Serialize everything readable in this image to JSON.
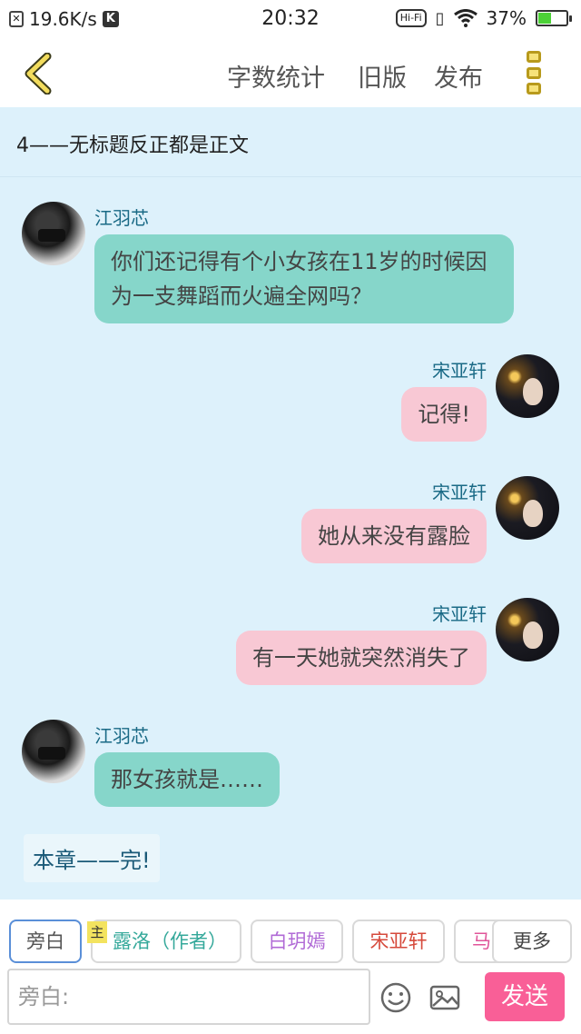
{
  "status_bar": {
    "net_speed": "19.6K/s",
    "time": "20:32",
    "hifi": "Hi-Fi",
    "battery": "37%",
    "battery_level": 0.37
  },
  "top_nav": {
    "word_count": "字数统计",
    "old_version": "旧版",
    "publish": "发布"
  },
  "chapter": {
    "title": "4——无标题反正都是正文"
  },
  "messages": [
    {
      "speaker": "江羽芯",
      "text": "你们还记得有个小女孩在11岁的时候因为一支舞蹈而火遍全网吗？",
      "side": "left"
    },
    {
      "speaker": "宋亚轩",
      "text": "记得!",
      "side": "right"
    },
    {
      "speaker": "宋亚轩",
      "text": "她从来没有露脸",
      "side": "right"
    },
    {
      "speaker": "宋亚轩",
      "text": "有一天她就突然消失了",
      "side": "right"
    },
    {
      "speaker": "江羽芯",
      "text": "那女孩就是……",
      "side": "left"
    }
  ],
  "end_note": "本章——完!",
  "roles": {
    "narration": "旁白",
    "main_tag": "主",
    "author": "露洛（作者）",
    "role2": "白玥嫣",
    "role3": "宋亚轩",
    "role4": "马",
    "more": "更多"
  },
  "composer": {
    "placeholder": "旁白:",
    "send": "发送"
  },
  "colors": {
    "chat_bg": "#ddf1fb",
    "left_bubble": "#86d6ca",
    "right_bubble": "#f8c8d4",
    "send_button": "#f95f97",
    "author_text": "#34a89a",
    "role2_text": "#b06ad6",
    "role3_text": "#d64a3c",
    "role4_text": "#e0559a"
  }
}
